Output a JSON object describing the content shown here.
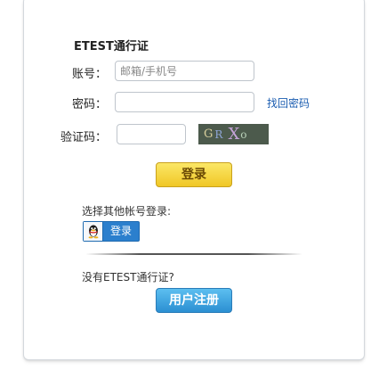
{
  "form": {
    "title": "ETEST通行证",
    "account_label": "账号：",
    "account_placeholder": "邮箱/手机号",
    "account_value": "",
    "password_label": "密码：",
    "password_value": "",
    "forgot_link": "找回密码",
    "captcha_label": "验证码：",
    "captcha_value": "",
    "captcha_chars": [
      "G",
      "R",
      "X",
      "o"
    ],
    "login_button": "登录"
  },
  "other_login": {
    "label": "选择其他帐号登录:",
    "qq_button_label": "登录",
    "qq_icon": "qq-penguin-icon"
  },
  "register": {
    "prompt": "没有ETEST通行证?",
    "button": "用户注册"
  },
  "colors": {
    "login_button": "#f0c726",
    "register_button": "#2b8fd2",
    "qq_button": "#2b7fcd",
    "link": "#1a5cb0"
  }
}
